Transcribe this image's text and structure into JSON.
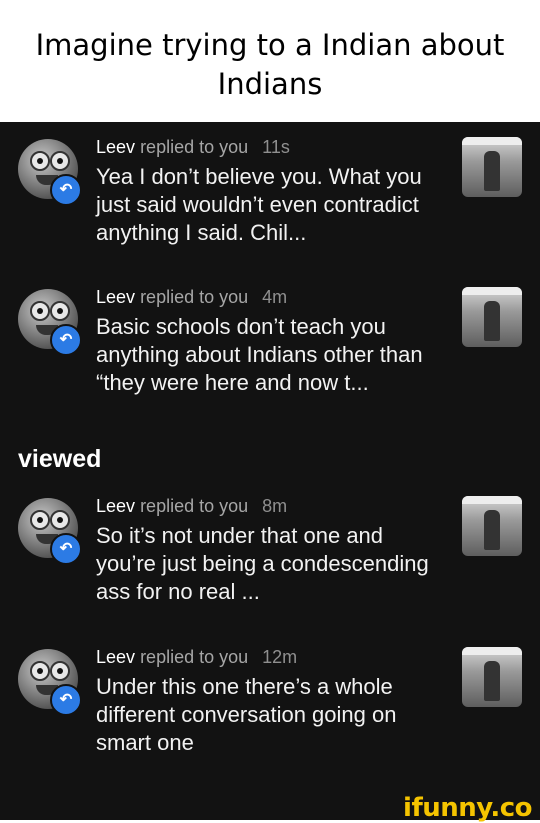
{
  "caption": {
    "text": "Imagine trying to a Indian about Indians"
  },
  "section_label": "viewed",
  "watermark": "ifunny.co",
  "notifications": [
    {
      "user": "Leev",
      "action": "replied to you",
      "time": "11s",
      "text": "Yea I don’t believe you. What you just said wouldn’t even contradict anything I said. Chil..."
    },
    {
      "user": "Leev",
      "action": "replied to you",
      "time": "4m",
      "text": "Basic schools don’t teach you anything about Indians other than “they were here and now t..."
    },
    {
      "user": "Leev",
      "action": "replied to you",
      "time": "8m",
      "text": "So it’s not under that one and you’re just being a condescending ass for no real ..."
    },
    {
      "user": "Leev",
      "action": "replied to you",
      "time": "12m",
      "text": "Under this one there’s a whole different conversation going on smart one"
    }
  ],
  "colors": {
    "panel_bg": "#121212",
    "reply_badge": "#2c7be5",
    "watermark": "#f5c400"
  },
  "icons": {
    "reply": "reply-arrow-icon"
  }
}
